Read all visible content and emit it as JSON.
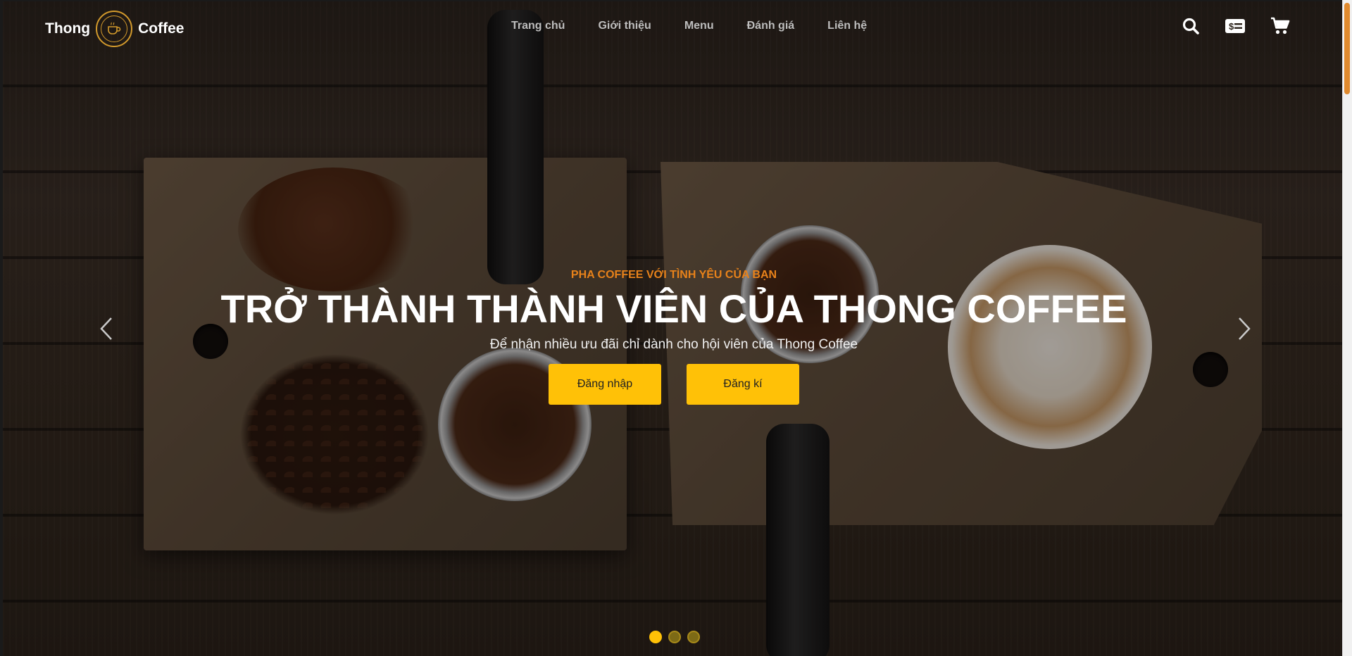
{
  "brand": {
    "left_word": "Thong",
    "right_word": "Coffee",
    "logo_icon": "coffee-cup-icon",
    "logo_alt": "Thong Coffee - Coffee Shop logo"
  },
  "nav": {
    "items": [
      {
        "label": "Trang chủ"
      },
      {
        "label": "Giới thiệu"
      },
      {
        "label": "Menu"
      },
      {
        "label": "Đánh giá"
      },
      {
        "label": "Liên hệ"
      }
    ]
  },
  "header_icons": [
    "search-icon",
    "money-bill-icon",
    "cart-icon"
  ],
  "hero": {
    "eyebrow": "PHA COFFEE VỚI TÌNH YÊU CỦA BẠN",
    "headline": "TRỞ THÀNH THÀNH VIÊN CỦA THONG COFFEE",
    "subtitle": "Để nhận nhiều ưu đãi chỉ dành cho hội viên của Thong Coffee",
    "login_label": "Đăng nhập",
    "register_label": "Đăng kí"
  },
  "carousel": {
    "slides": 3,
    "active_slide": 1
  },
  "colors": {
    "accent": "#ffc107",
    "eyebrow": "#e8821a",
    "logo_ring": "#d39a2c",
    "scroll_thumb": "#e08a2e"
  }
}
